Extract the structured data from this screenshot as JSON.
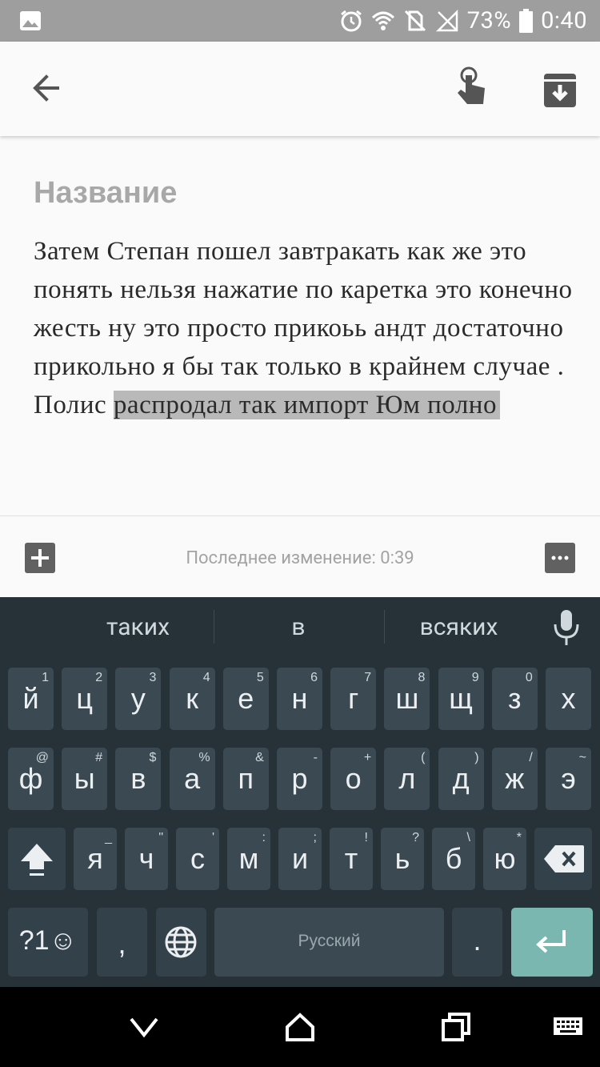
{
  "status_bar": {
    "battery_percent": "73%",
    "time": "0:40",
    "icons": [
      "image-icon",
      "alarm-icon",
      "wifi-icon",
      "no-sim-icon",
      "signal-off-icon",
      "battery-icon"
    ]
  },
  "app_bar": {
    "icons": [
      "back-arrow-icon",
      "touch-gesture-icon",
      "archive-icon"
    ]
  },
  "note": {
    "title_placeholder": "Название",
    "body_plain": "Затем Степан пошел завтракать как же это понять нельзя нажатие по каретка это конечно жесть ну это просто прикоьь андт достаточно прикольно я бы так только в крайнем случае . Полис ",
    "body_highlighted": "распродал так импорт Юм полно"
  },
  "bottom_bar": {
    "last_modified": "Последнее изменение: 0:39"
  },
  "keyboard": {
    "suggestions": [
      "таких",
      "в",
      "всяких"
    ],
    "row1": [
      {
        "k": "й",
        "h": "1"
      },
      {
        "k": "ц",
        "h": "2"
      },
      {
        "k": "у",
        "h": "3"
      },
      {
        "k": "к",
        "h": "4"
      },
      {
        "k": "е",
        "h": "5"
      },
      {
        "k": "н",
        "h": "6"
      },
      {
        "k": "г",
        "h": "7"
      },
      {
        "k": "ш",
        "h": "8"
      },
      {
        "k": "щ",
        "h": "9"
      },
      {
        "k": "з",
        "h": "0"
      },
      {
        "k": "х",
        "h": ""
      }
    ],
    "row2": [
      {
        "k": "ф",
        "h": "@"
      },
      {
        "k": "ы",
        "h": "#"
      },
      {
        "k": "в",
        "h": "$"
      },
      {
        "k": "а",
        "h": "%"
      },
      {
        "k": "п",
        "h": "&"
      },
      {
        "k": "р",
        "h": "-"
      },
      {
        "k": "о",
        "h": "+"
      },
      {
        "k": "л",
        "h": "("
      },
      {
        "k": "д",
        "h": ")"
      },
      {
        "k": "ж",
        "h": "/"
      },
      {
        "k": "э",
        "h": "~"
      }
    ],
    "row3": [
      {
        "k": "я",
        "h": "_"
      },
      {
        "k": "ч",
        "h": "\""
      },
      {
        "k": "с",
        "h": "'"
      },
      {
        "k": "м",
        "h": ":"
      },
      {
        "k": "и",
        "h": ";"
      },
      {
        "k": "т",
        "h": "!"
      },
      {
        "k": "ь",
        "h": "?"
      },
      {
        "k": "б",
        "h": "\\"
      },
      {
        "k": "ю",
        "h": "*"
      }
    ],
    "symbols_label": "?1☺",
    "comma": ",",
    "space_label": "Русский",
    "period": "."
  },
  "colors": {
    "status_bar": "#9e9e9e",
    "keyboard_bg": "#263238",
    "key_bg": "#3b4a52",
    "enter_key": "#7ab7b1",
    "highlight": "#b9b9b9"
  }
}
